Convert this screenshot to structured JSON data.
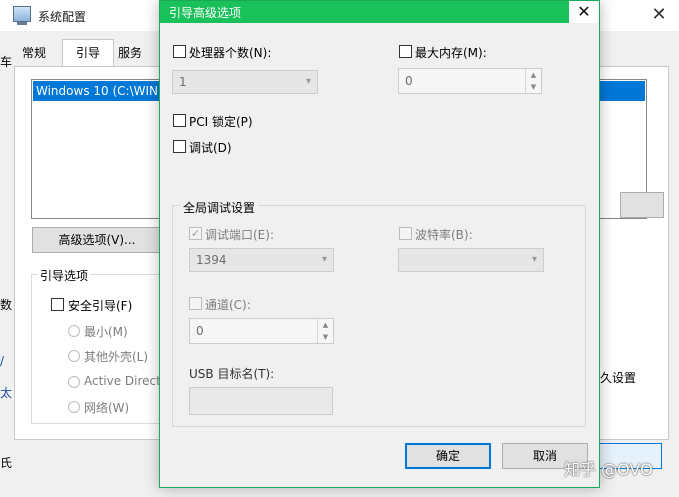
{
  "background_window": {
    "title": "系统配置",
    "close_glyph": "✕",
    "tabs": [
      "常规",
      "引导",
      "服务"
    ],
    "os_list_item": "Windows 10 (C:\\WINI",
    "advanced_button": "高级选项(V)...",
    "boot_options": {
      "title": "引导选项",
      "safe_boot": "安全引导(F)",
      "minimal": "最小(M)",
      "alternate_shell": "其他外壳(L)",
      "active_directory": "Active Directo",
      "network": "网络(W)"
    },
    "make_permanent": "久设置",
    "edge_chars": [
      "车",
      "",
      "数",
      "/",
      "太",
      "氏"
    ]
  },
  "dialog": {
    "title": "引导高级选项",
    "close_glyph": "✕",
    "processors": {
      "label": "处理器个数(N):",
      "value": "1",
      "checked": false
    },
    "max_memory": {
      "label": "最大内存(M):",
      "value": "0",
      "checked": false
    },
    "pci_lock": {
      "label": "PCI 锁定(P)",
      "checked": false
    },
    "debug": {
      "label": "调试(D)",
      "checked": false
    },
    "global_debug": {
      "title": "全局调试设置",
      "debug_port": {
        "label": "调试端口(E):",
        "value": "1394",
        "checked": true
      },
      "baud_rate": {
        "label": "波特率(B):",
        "value": "",
        "checked": false
      },
      "channel": {
        "label": "通道(C):",
        "value": "0",
        "checked": false
      },
      "usb_target": {
        "label": "USB 目标名(T):",
        "value": ""
      }
    },
    "ok": "确定",
    "cancel": "取消"
  },
  "watermark": "知乎 @OVO",
  "colors": {
    "titlebar_accent": "#1ac15a",
    "selection": "#0078d7"
  },
  "icons": {
    "dropdown": "▾",
    "spin_up": "▲",
    "spin_down": "▼",
    "checkmark": "✓"
  }
}
